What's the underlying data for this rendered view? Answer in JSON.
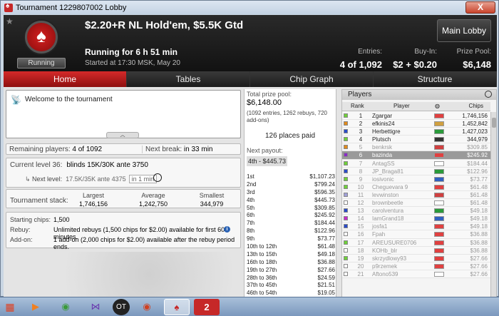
{
  "window": {
    "title": "Tournament 1229807002 Lobby",
    "close": "X"
  },
  "header": {
    "title": "$2.20+R NL Hold'em, $5.5K Gtd",
    "status_badge": "Running",
    "running_for": "Running for 6 h 51 min",
    "started_at": "Started at 17:30 MSK, May 20",
    "entries_label": "Entries:",
    "entries_value": "4 of 1,092",
    "buyin_label": "Buy-In:",
    "buyin_value": "$2 + $0.20",
    "prize_label": "Prize Pool:",
    "prize_value": "$6,148",
    "main_lobby": "Main Lobby"
  },
  "tabs": [
    "Home",
    "Tables",
    "Chip Graph",
    "Structure"
  ],
  "home": {
    "welcome": "Welcome to the tournament",
    "remaining_label": "Remaining players:",
    "remaining_value": "4 of 1092",
    "next_break_label": "Next break:",
    "next_break_value": "in 33 min",
    "current_level_label": "Current level 36:",
    "current_level_value": "blinds 15K/30K ante 3750",
    "next_level_label": "Next level:",
    "next_level_value": "17.5K/35K ante 4375",
    "next_level_in": "in 1 min",
    "stack_label": "Tournament stack:",
    "largest_label": "Largest",
    "largest_value": "1,746,156",
    "average_label": "Average",
    "average_value": "1,242,750",
    "smallest_label": "Smallest",
    "smallest_value": "344,979",
    "starting_label": "Starting chips:",
    "starting_value": "1,500",
    "rebuy_label": "Rebuy:",
    "rebuy_value": "Unlimited rebuys (1,500 chips for $2.00) available for first 60 minutes.",
    "addon_label": "Add-on:",
    "addon_value": "1 add-on (2,000 chips for $2.00) available after the rebuy period ends."
  },
  "prize": {
    "total_label": "Total prize pool:",
    "total_value": "$6,148.00",
    "entries_note": "(1092 entries, 1262 rebuys, 720 add-ons)",
    "places_paid": "126 places paid",
    "next_payout_label": "Next payout:",
    "next_payout_value": "4th - $445.73",
    "payouts": [
      {
        "place": "1st",
        "amount": "$1,107.23"
      },
      {
        "place": "2nd",
        "amount": "$799.24"
      },
      {
        "place": "3rd",
        "amount": "$596.35"
      },
      {
        "place": "4th",
        "amount": "$445.73"
      },
      {
        "place": "5th",
        "amount": "$309.85"
      },
      {
        "place": "6th",
        "amount": "$245.92"
      },
      {
        "place": "7th",
        "amount": "$184.44"
      },
      {
        "place": "8th",
        "amount": "$122.96"
      },
      {
        "place": "9th",
        "amount": "$73.77"
      },
      {
        "place": "10th to 12th",
        "amount": "$61.48"
      },
      {
        "place": "13th to 15th",
        "amount": "$49.18"
      },
      {
        "place": "16th to 18th",
        "amount": "$36.88"
      },
      {
        "place": "19th to 27th",
        "amount": "$27.66"
      },
      {
        "place": "28th to 36th",
        "amount": "$24.59"
      },
      {
        "place": "37th to 45th",
        "amount": "$21.51"
      },
      {
        "place": "46th to 54th",
        "amount": "$19.05"
      }
    ]
  },
  "players": {
    "title": "Players",
    "col_rank": "Rank",
    "col_player": "Player",
    "col_chips": "Chips",
    "rows": [
      {
        "rank": "1",
        "name": "Zgargar",
        "chips": "1,746,156",
        "color": "#6fcf3a",
        "flag": "#e04040",
        "dim": false
      },
      {
        "rank": "2",
        "name": "efkinis24",
        "chips": "1,452,842",
        "color": "#e08a1c",
        "flag": "#d0a040",
        "dim": false
      },
      {
        "rank": "3",
        "name": "Herbettigre",
        "chips": "1,427,023",
        "color": "#2a4cc8",
        "flag": "#2a9a3a",
        "dim": false
      },
      {
        "rank": "4",
        "name": "Plutsch",
        "chips": "344,979",
        "color": "#6fcf3a",
        "flag": "#333333",
        "dim": false
      },
      {
        "rank": "5",
        "name": "benkrsk",
        "chips": "$309.85",
        "color": "#e08a1c",
        "flag": "#d04040",
        "dim": true
      },
      {
        "rank": "6",
        "name": "bazinda",
        "chips": "$245.92",
        "color": "#8a2ac8",
        "flag": "#e04040",
        "dim": false,
        "sel": true
      },
      {
        "rank": "7",
        "name": "AntagSS",
        "chips": "$184.44",
        "color": "#6fcf3a",
        "flag": "#ffffff",
        "dim": true
      },
      {
        "rank": "8",
        "name": "JP_Braga81",
        "chips": "$122.96",
        "color": "#2a4cc8",
        "flag": "#2a9a3a",
        "dim": true
      },
      {
        "rank": "9",
        "name": "iosivonic",
        "chips": "$73.77",
        "color": "#6fcf3a",
        "flag": "#3060c0",
        "dim": true
      },
      {
        "rank": "10",
        "name": "Cheguevara 9",
        "chips": "$61.48",
        "color": "#6fcf3a",
        "flag": "#e04040",
        "dim": true
      },
      {
        "rank": "11",
        "name": "levwinston",
        "chips": "$61.48",
        "color": "#a0a0d8",
        "flag": "#d04040",
        "dim": true
      },
      {
        "rank": "12",
        "name": "brownbeetle",
        "chips": "$61.48",
        "color": "#ffffff",
        "flag": "#ffffff",
        "dim": true
      },
      {
        "rank": "13",
        "name": "carolventura",
        "chips": "$49.18",
        "color": "#2a4cc8",
        "flag": "#2a9a3a",
        "dim": true
      },
      {
        "rank": "14",
        "name": "IamGrand18",
        "chips": "$49.18",
        "color": "#c82ac8",
        "flag": "#3060c0",
        "dim": true
      },
      {
        "rank": "15",
        "name": "josfa1",
        "chips": "$49.18",
        "color": "#2a4cc8",
        "flag": "#e04040",
        "dim": true
      },
      {
        "rank": "16",
        "name": "Fpah",
        "chips": "$36.88",
        "color": "#ffffff",
        "flag": "#e04040",
        "dim": true
      },
      {
        "rank": "17",
        "name": "AREUSURE0706",
        "chips": "$36.88",
        "color": "#6fcf3a",
        "flag": "#e04040",
        "dim": true
      },
      {
        "rank": "18",
        "name": "KOHb_blr",
        "chips": "$36.88",
        "color": "#ffffff",
        "flag": "#e04040",
        "dim": true
      },
      {
        "rank": "19",
        "name": "skrzydlowy93",
        "chips": "$27.66",
        "color": "#6fcf3a",
        "flag": "#e04040",
        "dim": true
      },
      {
        "rank": "20",
        "name": "p9rzemek",
        "chips": "$27.66",
        "color": "#ffffff",
        "flag": "#e04040",
        "dim": true
      },
      {
        "rank": "21",
        "name": "Aftono539",
        "chips": "$27.66",
        "color": "#ffffff",
        "flag": "#ffffff",
        "dim": true
      }
    ]
  },
  "taskbar": [
    "start-orb",
    "media-player",
    "chrome",
    "visual-studio",
    "opera-tablet",
    "chrome",
    "pokerstars",
    "app-2"
  ],
  "taskbar_labels": {
    "ot": "OT",
    "two": "2"
  }
}
